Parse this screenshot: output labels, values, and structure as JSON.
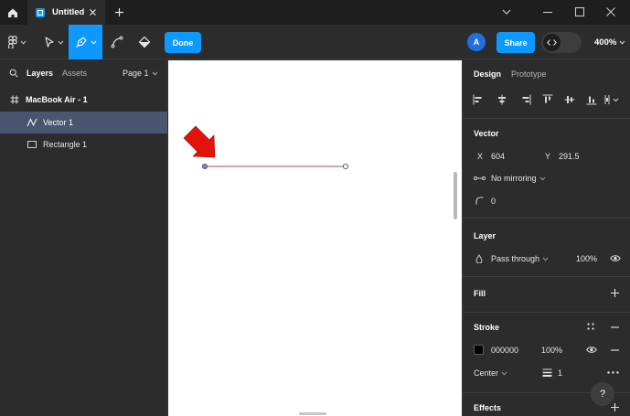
{
  "titlebar": {
    "tab_title": "Untitled",
    "icons": [
      "home-icon",
      "figma-file-icon",
      "close-icon",
      "plus-icon",
      "chevron-down-icon",
      "minimize-icon",
      "maximize-icon",
      "close-icon"
    ]
  },
  "toolbar": {
    "done_label": "Done",
    "avatar_initial": "A",
    "share_label": "Share",
    "zoom_label": "400%",
    "active_color": "#0d99ff"
  },
  "left_panel": {
    "tabs": {
      "layers": "Layers",
      "assets": "Assets"
    },
    "page_label": "Page 1",
    "layers": [
      {
        "name": "MacBook Air - 1",
        "icon": "frame-hash-icon"
      },
      {
        "name": "Vector 1",
        "icon": "vector-path-icon",
        "selected": true
      },
      {
        "name": "Rectangle 1",
        "icon": "rectangle-icon"
      }
    ]
  },
  "right_panel": {
    "tabs": {
      "design": "Design",
      "prototype": "Prototype"
    },
    "vector": {
      "title": "Vector",
      "x_label": "X",
      "x_value": "604",
      "y_label": "Y",
      "y_value": "291.5",
      "mirroring": "No mirroring",
      "corner_radius": "0"
    },
    "layer": {
      "title": "Layer",
      "blend_mode": "Pass through",
      "opacity": "100%"
    },
    "fill": {
      "title": "Fill"
    },
    "stroke": {
      "title": "Stroke",
      "color_hex": "000000",
      "opacity": "100%",
      "position": "Center",
      "weight": "1"
    },
    "effects": {
      "title": "Effects"
    },
    "help_label": "?"
  },
  "canvas": {
    "annotation_arrow_color": "#e3120b",
    "line_color": "#c07070"
  }
}
